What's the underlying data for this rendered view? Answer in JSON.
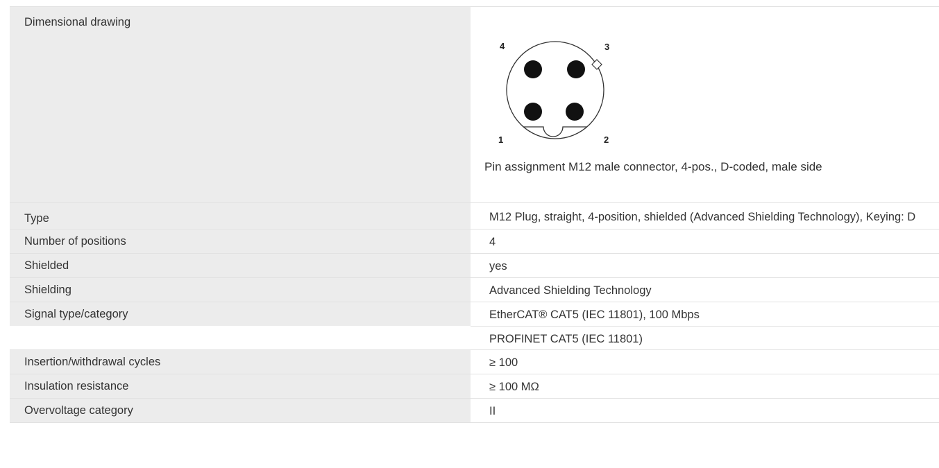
{
  "specs": {
    "drawing": {
      "label": "Dimensional drawing",
      "pins": {
        "p1": "1",
        "p2": "2",
        "p3": "3",
        "p4": "4"
      },
      "caption": "Pin assignment M12 male connector, 4-pos., D-coded, male side"
    },
    "type": {
      "label": "Type",
      "value": "M12 Plug, straight, 4-position, shielded (Advanced Shielding Technology), Keying: D"
    },
    "positions": {
      "label": "Number of positions",
      "value": "4"
    },
    "shielded": {
      "label": "Shielded",
      "value": "yes"
    },
    "shielding": {
      "label": "Shielding",
      "value": "Advanced Shielding Technology"
    },
    "signal": {
      "label": "Signal type/category",
      "values": [
        "EtherCAT® CAT5 (IEC 11801), 100 Mbps",
        "PROFINET CAT5 (IEC 11801)"
      ]
    },
    "cycles": {
      "label": "Insertion/withdrawal cycles",
      "value": "≥ 100"
    },
    "insulation": {
      "label": "Insulation resistance",
      "value": "≥ 100 MΩ"
    },
    "overvoltage": {
      "label": "Overvoltage category",
      "value": "II"
    }
  }
}
